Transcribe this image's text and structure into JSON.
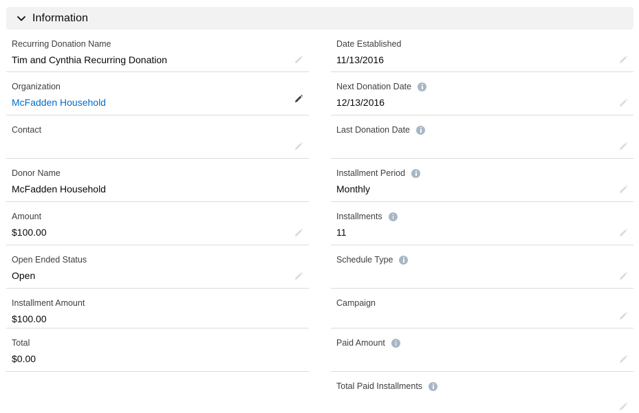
{
  "section": {
    "title": "Information",
    "chevron_icon": "chevron-down-icon"
  },
  "left_fields": [
    {
      "label": "Recurring Donation Name",
      "value": "Tim and Cynthia Recurring Donation"
    },
    {
      "label": "Organization",
      "value": "McFadden Household"
    },
    {
      "label": "Contact",
      "value": ""
    },
    {
      "label": "Donor Name",
      "value": "McFadden Household"
    },
    {
      "label": "Amount",
      "value": "$100.00"
    },
    {
      "label": "Open Ended Status",
      "value": "Open"
    },
    {
      "label": "Installment Amount",
      "value": "$100.00"
    },
    {
      "label": "Total",
      "value": "$0.00"
    }
  ],
  "right_fields": [
    {
      "label": "Date Established",
      "value": "11/13/2016"
    },
    {
      "label": "Next Donation Date",
      "value": "12/13/2016"
    },
    {
      "label": "Last Donation Date",
      "value": ""
    },
    {
      "label": "Installment Period",
      "value": "Monthly"
    },
    {
      "label": "Installments",
      "value": "11"
    },
    {
      "label": "Schedule Type",
      "value": ""
    },
    {
      "label": "Campaign",
      "value": ""
    },
    {
      "label": "Paid Amount",
      "value": ""
    },
    {
      "label": "Total Paid Installments",
      "value": ""
    }
  ],
  "colors": {
    "link": "#006dcc",
    "header_bg": "#f3f2f2",
    "pencil_faint": "#dddbda",
    "pencil_active": "#3e3e3c",
    "info_icon": "#a8b7c7"
  }
}
